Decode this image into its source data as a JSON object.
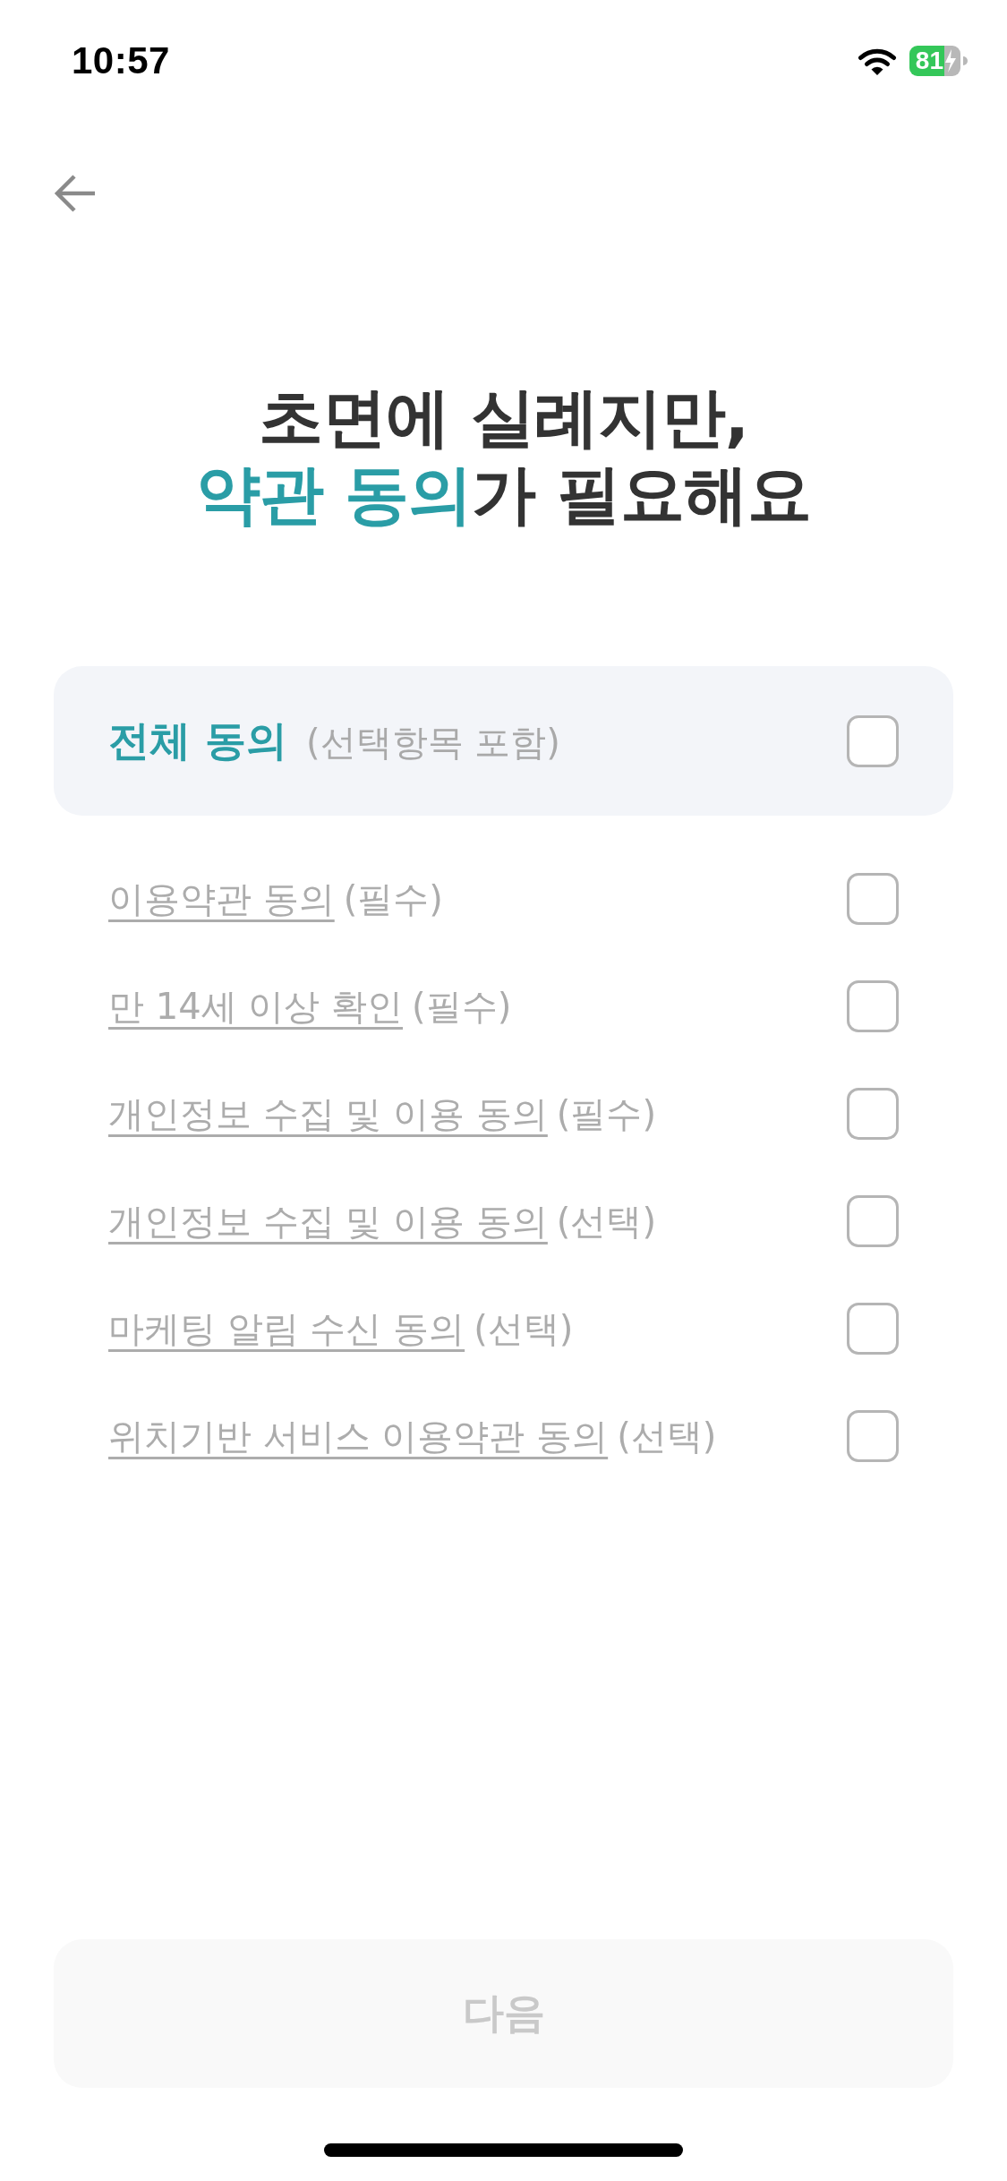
{
  "status_bar": {
    "time": "10:57",
    "battery": "81"
  },
  "title": {
    "lines": [
      [
        {
          "text": "초면에 실례지만,",
          "accent": false
        }
      ],
      [
        {
          "text": "약관 동의",
          "accent": true
        },
        {
          "text": "가 필요해요",
          "accent": false
        }
      ]
    ]
  },
  "agree_all": {
    "label": "전체 동의",
    "note": "(선택항목 포함)",
    "checked": false
  },
  "terms": [
    {
      "label": "이용약관 동의",
      "note": "(필수)",
      "checked": false
    },
    {
      "label": "만 14세 이상 확인",
      "note": "(필수)",
      "checked": false
    },
    {
      "label": "개인정보 수집 및 이용 동의",
      "note": "(필수)",
      "checked": false
    },
    {
      "label": "개인정보 수집 및 이용 동의",
      "note": "(선택)",
      "checked": false
    },
    {
      "label": "마케팅 알림 수신 동의",
      "note": "(선택)",
      "checked": false
    },
    {
      "label": "위치기반 서비스 이용약관 동의",
      "note": "(선택)",
      "checked": false
    }
  ],
  "next_button": {
    "label": "다음",
    "disabled": true
  }
}
